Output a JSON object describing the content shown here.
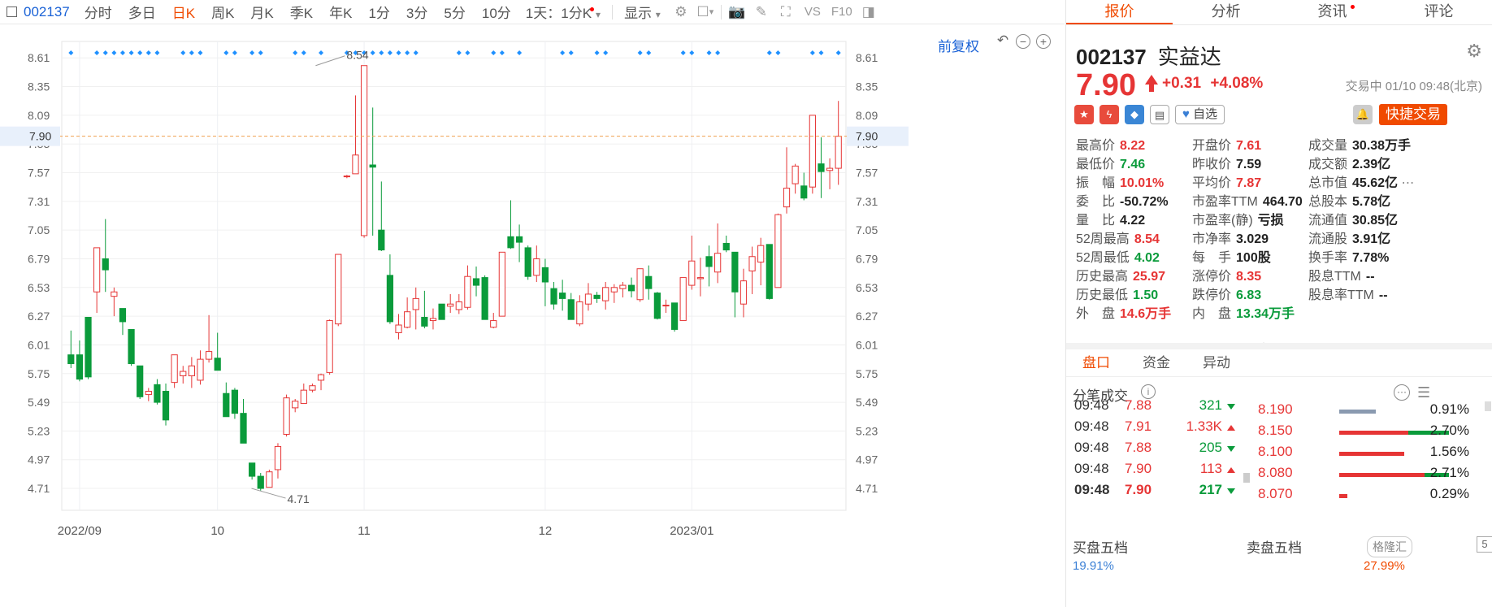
{
  "toolbar": {
    "code": "002137",
    "periods": [
      "分时",
      "多日",
      "日K",
      "周K",
      "月K",
      "季K",
      "年K",
      "1分",
      "3分",
      "5分",
      "10分"
    ],
    "active_period": "日K",
    "multi_day_select": "1天：1分K",
    "display_label": "显示"
  },
  "chart": {
    "fuquan_label": "前复权",
    "y_ticks": [
      "8.61",
      "8.35",
      "8.09",
      "7.83",
      "7.57",
      "7.31",
      "7.05",
      "6.79",
      "6.53",
      "6.27",
      "6.01",
      "5.75",
      "5.49",
      "5.23",
      "4.97",
      "4.71"
    ],
    "current_price_label": "7.90",
    "x_labels": [
      {
        "label": "2022/09",
        "index": 1
      },
      {
        "label": "10",
        "index": 17
      },
      {
        "label": "11",
        "index": 34
      },
      {
        "label": "12",
        "index": 55
      },
      {
        "label": "2023/01",
        "index": 72
      }
    ],
    "high_label": "8.54",
    "low_label": "4.71"
  },
  "chart_data": {
    "type": "candlestick",
    "current_price": 7.9,
    "ylim": [
      4.6,
      8.7
    ],
    "high_mark": {
      "value": 8.54,
      "index": 28
    },
    "low_mark": {
      "value": 4.71,
      "index": 20
    },
    "candles": [
      [
        5.92,
        5.84,
        6.14,
        5.8
      ],
      [
        5.92,
        5.7,
        6.05,
        5.68
      ],
      [
        6.26,
        5.72,
        6.26,
        5.7
      ],
      [
        6.49,
        6.89,
        6.89,
        6.3
      ],
      [
        6.79,
        6.69,
        7.15,
        6.49
      ],
      [
        6.45,
        6.49,
        6.53,
        6.27
      ],
      [
        6.34,
        6.22,
        6.34,
        6.1
      ],
      [
        6.15,
        5.84,
        6.15,
        5.82
      ],
      [
        5.82,
        5.54,
        5.82,
        5.52
      ],
      [
        5.56,
        5.59,
        5.62,
        5.5
      ],
      [
        5.65,
        5.49,
        5.7,
        5.47
      ],
      [
        5.59,
        5.33,
        5.66,
        5.28
      ],
      [
        5.67,
        5.92,
        5.92,
        5.62
      ],
      [
        5.73,
        5.77,
        5.82,
        5.66
      ],
      [
        5.73,
        5.82,
        5.9,
        5.62
      ],
      [
        5.69,
        5.88,
        5.96,
        5.65
      ],
      [
        5.88,
        5.95,
        6.28,
        5.85
      ],
      [
        5.89,
        5.78,
        6.12,
        5.78
      ],
      [
        5.57,
        5.36,
        5.67,
        5.36
      ],
      [
        5.6,
        5.39,
        5.62,
        5.34
      ],
      [
        5.39,
        5.12,
        5.52,
        5.12
      ],
      [
        4.94,
        4.82,
        4.94,
        4.79
      ],
      [
        4.82,
        4.71,
        4.85,
        4.69
      ],
      [
        4.72,
        4.86,
        4.88,
        4.73
      ],
      [
        4.88,
        5.09,
        5.12,
        4.8
      ],
      [
        5.2,
        5.53,
        5.56,
        5.18
      ],
      [
        5.44,
        5.5,
        5.52,
        5.4
      ],
      [
        5.48,
        5.6,
        5.66,
        5.48
      ],
      [
        5.6,
        5.64,
        5.66,
        5.58
      ],
      [
        5.69,
        5.74,
        5.75,
        5.6
      ],
      [
        5.76,
        6.23,
        6.24,
        5.74
      ],
      [
        6.2,
        6.83,
        6.83,
        6.18
      ],
      [
        7.54,
        7.54,
        7.55,
        7.52
      ],
      [
        7.56,
        7.73,
        8.27,
        7.56
      ],
      [
        7.0,
        8.54,
        8.54,
        6.98
      ],
      [
        7.64,
        7.62,
        8.16,
        7.0
      ],
      [
        7.05,
        6.87,
        7.49,
        6.86
      ],
      [
        6.64,
        6.22,
        6.83,
        6.2
      ],
      [
        6.12,
        6.19,
        6.29,
        6.06
      ],
      [
        6.17,
        6.31,
        6.44,
        6.16
      ],
      [
        6.33,
        6.43,
        6.53,
        6.15
      ],
      [
        6.26,
        6.18,
        6.5,
        6.16
      ],
      [
        6.23,
        6.25,
        6.34,
        6.15
      ],
      [
        6.38,
        6.24,
        6.36,
        6.24
      ],
      [
        6.36,
        6.38,
        6.47,
        6.3
      ],
      [
        6.33,
        6.4,
        6.47,
        6.29
      ],
      [
        6.35,
        6.63,
        6.73,
        6.33
      ],
      [
        6.61,
        6.55,
        6.72,
        6.45
      ],
      [
        6.62,
        6.24,
        6.64,
        6.24
      ],
      [
        6.17,
        6.23,
        6.3,
        6.16
      ],
      [
        6.27,
        6.85,
        6.85,
        6.27
      ],
      [
        6.99,
        6.89,
        7.32,
        6.88
      ],
      [
        6.99,
        6.94,
        7.1,
        6.76
      ],
      [
        6.89,
        6.63,
        6.91,
        6.6
      ],
      [
        6.64,
        6.79,
        6.91,
        6.58
      ],
      [
        6.71,
        6.58,
        6.79,
        6.36
      ],
      [
        6.52,
        6.38,
        6.58,
        6.33
      ],
      [
        6.48,
        6.43,
        6.6,
        6.32
      ],
      [
        6.42,
        6.24,
        6.48,
        6.24
      ],
      [
        6.2,
        6.4,
        6.46,
        6.18
      ],
      [
        6.38,
        6.47,
        6.57,
        6.32
      ],
      [
        6.46,
        6.43,
        6.49,
        6.39
      ],
      [
        6.41,
        6.53,
        6.58,
        6.33
      ],
      [
        6.49,
        6.53,
        6.56,
        6.39
      ],
      [
        6.52,
        6.55,
        6.58,
        6.44
      ],
      [
        6.55,
        6.5,
        6.62,
        6.44
      ],
      [
        6.42,
        6.7,
        6.7,
        6.4
      ],
      [
        6.63,
        6.52,
        6.73,
        6.42
      ],
      [
        6.48,
        6.25,
        6.49,
        6.24
      ],
      [
        6.37,
        6.37,
        6.42,
        6.3
      ],
      [
        6.39,
        6.15,
        6.39,
        6.13
      ],
      [
        6.23,
        6.62,
        6.62,
        6.26
      ],
      [
        6.55,
        6.77,
        7.0,
        6.51
      ],
      [
        6.61,
        6.62,
        6.8,
        6.45
      ],
      [
        6.81,
        6.72,
        6.91,
        6.54
      ],
      [
        6.67,
        6.84,
        7.11,
        6.57
      ],
      [
        6.93,
        6.87,
        7.0,
        6.85
      ],
      [
        6.85,
        6.49,
        6.85,
        6.26
      ],
      [
        6.38,
        6.59,
        6.7,
        6.26
      ],
      [
        6.68,
        6.81,
        6.9,
        6.47
      ],
      [
        6.76,
        6.91,
        6.98,
        6.55
      ],
      [
        6.92,
        6.43,
        6.86,
        6.42
      ],
      [
        6.53,
        7.19,
        7.2,
        6.54
      ],
      [
        7.26,
        7.43,
        7.8,
        7.2
      ],
      [
        7.47,
        7.63,
        7.65,
        7.38
      ],
      [
        7.45,
        7.34,
        7.57,
        7.32
      ],
      [
        7.44,
        8.09,
        8.09,
        7.38
      ],
      [
        7.65,
        7.58,
        7.89,
        7.34
      ],
      [
        7.59,
        7.61,
        7.7,
        7.42
      ],
      [
        7.61,
        7.9,
        8.22,
        7.46
      ]
    ]
  },
  "quote_tabs": [
    "报价",
    "分析",
    "资讯",
    "评论"
  ],
  "quote_tab_active": "报价",
  "stock": {
    "code": "002137",
    "name": "实益达",
    "price": "7.90",
    "change": "+0.31",
    "change_pct": "+4.08%",
    "trade_info": "交易中 01/10 09:48(北京)",
    "watch_label": "自选",
    "quick_trade_label": "快捷交易"
  },
  "stats": [
    [
      {
        "l": "最高价",
        "v": "8.22",
        "c": "red"
      },
      {
        "l": "开盘价",
        "v": "7.61",
        "c": "red"
      },
      {
        "l": "成交量",
        "v": "30.38万手",
        "c": "dark"
      }
    ],
    [
      {
        "l": "最低价",
        "v": "7.46",
        "c": "green"
      },
      {
        "l": "昨收价",
        "v": "7.59",
        "c": "dark"
      },
      {
        "l": "成交额",
        "v": "2.39亿",
        "c": "dark"
      }
    ],
    [
      {
        "l": "振　幅",
        "v": "10.01%",
        "c": "red"
      },
      {
        "l": "平均价",
        "v": "7.87",
        "c": "red"
      },
      {
        "l": "总市值",
        "v": "45.62亿",
        "c": "dark"
      }
    ],
    [
      {
        "l": "委　比",
        "v": "-50.72%",
        "c": "dark"
      },
      {
        "l": "市盈率TTM",
        "v": "464.70",
        "c": "dark"
      },
      {
        "l": "总股本",
        "v": "5.78亿",
        "c": "dark"
      }
    ],
    [
      {
        "l": "量　比",
        "v": "4.22",
        "c": "dark"
      },
      {
        "l": "市盈率(静)",
        "v": "亏损",
        "c": "dark"
      },
      {
        "l": "流通值",
        "v": "30.85亿",
        "c": "dark"
      }
    ],
    [
      {
        "l": "52周最高",
        "v": "8.54",
        "c": "red"
      },
      {
        "l": "市净率",
        "v": "3.029",
        "c": "dark"
      },
      {
        "l": "流通股",
        "v": "3.91亿",
        "c": "dark"
      }
    ],
    [
      {
        "l": "52周最低",
        "v": "4.02",
        "c": "green"
      },
      {
        "l": "每　手",
        "v": "100股",
        "c": "dark"
      },
      {
        "l": "换手率",
        "v": "7.78%",
        "c": "dark"
      }
    ],
    [
      {
        "l": "历史最高",
        "v": "25.97",
        "c": "red"
      },
      {
        "l": "涨停价",
        "v": "8.35",
        "c": "red"
      },
      {
        "l": "股息TTM",
        "v": "--",
        "c": "dark"
      }
    ],
    [
      {
        "l": "历史最低",
        "v": "1.50",
        "c": "green"
      },
      {
        "l": "跌停价",
        "v": "6.83",
        "c": "green"
      },
      {
        "l": "股息率TTM",
        "v": "--",
        "c": "dark"
      }
    ],
    [
      {
        "l": "外　盘",
        "v": "14.6万手",
        "c": "red"
      },
      {
        "l": "内　盘",
        "v": "13.34万手",
        "c": "green"
      },
      {
        "l": "",
        "v": "",
        "c": "dark"
      }
    ]
  ],
  "sub_tabs": [
    "盘口",
    "资金",
    "异动"
  ],
  "sub_tab_active": "盘口",
  "trades_title": "分笔成交",
  "trades": [
    {
      "time": "09:48",
      "price": "7.88",
      "pc": "red",
      "vol": "321",
      "vc": "green",
      "dir": "dn"
    },
    {
      "time": "09:48",
      "price": "7.91",
      "pc": "red",
      "vol": "1.33K",
      "vc": "red",
      "dir": "up"
    },
    {
      "time": "09:48",
      "price": "7.88",
      "pc": "red",
      "vol": "205",
      "vc": "green",
      "dir": "dn"
    },
    {
      "time": "09:48",
      "price": "7.90",
      "pc": "red",
      "vol": "113",
      "vc": "red",
      "dir": "up"
    },
    {
      "time": "09:48",
      "price": "7.90",
      "pc": "red",
      "vol": "217",
      "vc": "green",
      "dir": "dn"
    }
  ],
  "levels": [
    {
      "price": "8.190",
      "pct": "0.91%",
      "red": 0.0,
      "green": 0.0,
      "gray": 0.09
    },
    {
      "price": "8.150",
      "pct": "2.70%",
      "red": 0.17,
      "green": 0.1,
      "gray": 0
    },
    {
      "price": "8.100",
      "pct": "1.56%",
      "red": 0.16,
      "green": 0.0,
      "gray": 0
    },
    {
      "price": "8.080",
      "pct": "2.71%",
      "red": 0.21,
      "green": 0.06,
      "gray": 0
    },
    {
      "price": "8.070",
      "pct": "0.29%",
      "red": 0.02,
      "green": 0.0,
      "gray": 0
    }
  ],
  "buy5_title": "买盘五档",
  "sell5_title": "卖盘五档",
  "buy_cut": "19.91%",
  "sell_cut": "27.99%",
  "watermark": "格隆汇",
  "page_btn": "5"
}
